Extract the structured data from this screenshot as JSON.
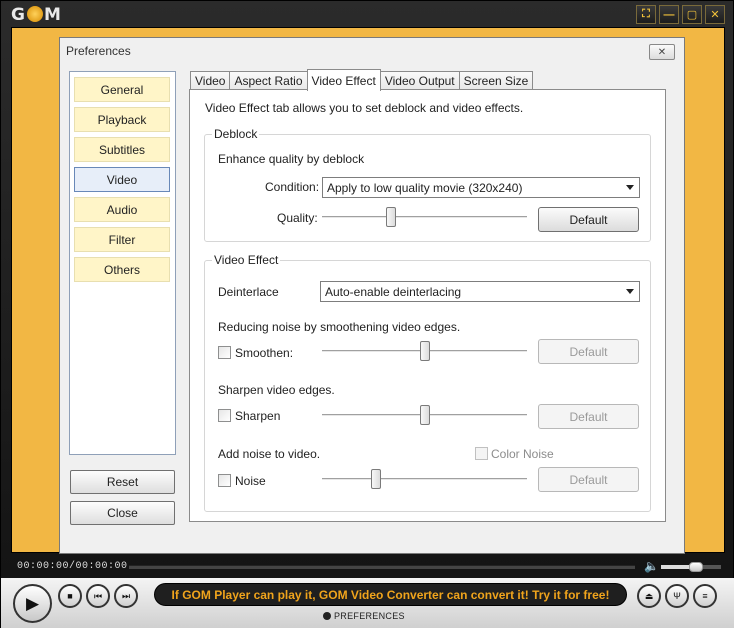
{
  "app": {
    "logo": "GOM",
    "window_buttons": [
      "⛶",
      "—",
      "▢",
      "✕"
    ]
  },
  "dialog": {
    "title": "Preferences",
    "close": "✕",
    "categories": [
      "General",
      "Playback",
      "Subtitles",
      "Video",
      "Audio",
      "Filter",
      "Others"
    ],
    "selected_category": "Video",
    "reset_label": "Reset",
    "close_label": "Close",
    "tabs": [
      "Video",
      "Aspect Ratio",
      "Video Effect",
      "Video Output",
      "Screen Size"
    ],
    "active_tab": "Video Effect",
    "description": "Video Effect tab allows you to set deblock and video effects."
  },
  "deblock": {
    "title": "Deblock",
    "enhance_label": "Enhance quality by deblock",
    "condition_label": "Condition:",
    "condition_value": "Apply to low quality movie (320x240)",
    "quality_label": "Quality:",
    "quality_level": 0.33,
    "default_label": "Default"
  },
  "video_effect": {
    "title": "Video Effect",
    "deinterlace_label": "Deinterlace",
    "deinterlace_value": "Auto-enable deinterlacing",
    "smoothen_desc": "Reducing noise by smoothening video edges.",
    "smoothen_label": "Smoothen:",
    "smoothen_checked": false,
    "smoothen_level": 0.5,
    "sharpen_desc": "Sharpen video edges.",
    "sharpen_label": "Sharpen",
    "sharpen_checked": false,
    "sharpen_level": 0.5,
    "noise_desc": "Add noise to video.",
    "color_noise_label": "Color Noise",
    "color_noise_checked": false,
    "noise_label": "Noise",
    "noise_checked": false,
    "noise_level": 0.25,
    "default_label": "Default"
  },
  "player": {
    "time": "00:00:00/00:00:00",
    "volume_icon": "🔈",
    "play_icon": "▶",
    "stop_icon": "■",
    "prev_icon": "⏮",
    "next_icon": "⏭",
    "marquee": "If GOM Player can play it, GOM Video Converter can convert it! Try it for free!",
    "preferences_label": "PREFERENCES",
    "eject_icon": "⏏",
    "equalizer_icon": "Ψ",
    "playlist_icon": "≡"
  },
  "colors": {
    "video_bg": "#f2b744",
    "marquee_text": "#f0a41c",
    "selected_category_bg": "#e7eef9",
    "category_bg": "#fff5c8"
  }
}
